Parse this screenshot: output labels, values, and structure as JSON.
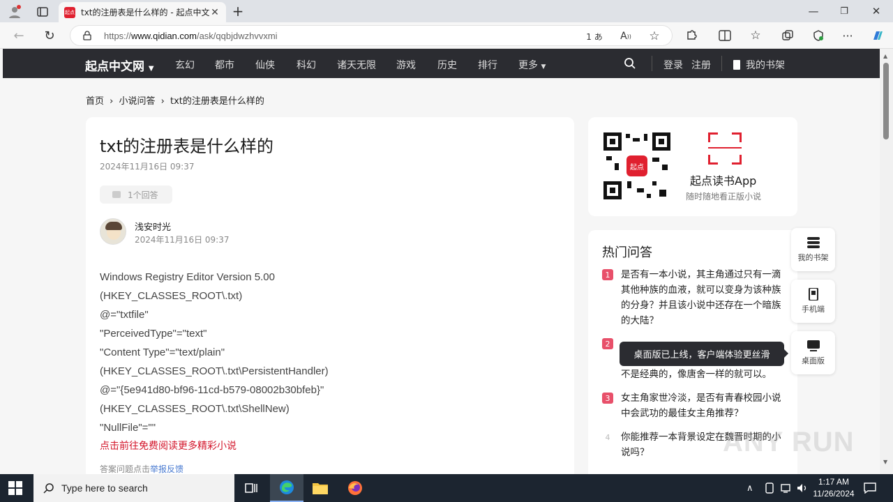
{
  "browser": {
    "tab_title": "txt的注册表是什么样的 - 起点中文",
    "favicon_text": "起点",
    "url_prefix": "https://",
    "url_domain": "www.qidian.com",
    "url_path": "/ask/qqbjdwzhvvxmi",
    "read_aloud_label": "1 あ"
  },
  "site": {
    "logo": "起点中文网",
    "nav": [
      "玄幻",
      "都市",
      "仙侠",
      "科幻",
      "诸天无限",
      "游戏",
      "历史",
      "排行",
      "更多"
    ],
    "login": "登录",
    "register": "注册",
    "bookshelf": "我的书架"
  },
  "breadcrumb": {
    "home": "首页",
    "section": "小说问答",
    "current": "txt的注册表是什么样的"
  },
  "question": {
    "title": "txt的注册表是什么样的",
    "date": "2024年11月16日 09:37",
    "answer_count": "1个回答"
  },
  "answer": {
    "author": "浅安时光",
    "date": "2024年11月16日 09:37",
    "lines": [
      "Windows Registry Editor Version 5.00",
      "(HKEY_CLASSES_ROOT\\.txt)",
      "@=\"txtfile\"",
      "\"PerceivedType\"=\"text\"",
      "\"Content Type\"=\"text/plain\"",
      "(HKEY_CLASSES_ROOT\\.txt\\PersistentHandler)",
      "@=\"{5e941d80-bf96-11cd-b579-08002b30bfeb}\"",
      "(HKEY_CLASSES_ROOT\\.txt\\ShellNew)",
      "\"NullFile\"=\"\""
    ],
    "cta": "点击前往免费阅读更多精彩小说",
    "report_prefix": "答案问题点击",
    "report_link": "举报反馈"
  },
  "app_promo": {
    "qr_label": "起点",
    "name": "起点读书App",
    "subtitle": "随时随地看正版小说"
  },
  "hot": {
    "title": "热门问答",
    "items": [
      {
        "rank": "1",
        "text": "是否有一本小说，其主角通过只有一滴其他种族的血液，就可以变身为该种族的分身？并且该小说中还存在一个暗族的大陆？"
      },
      {
        "rank": "2",
        "text": "不是经典的，像唐舍一样的就可以。"
      },
      {
        "rank": "3",
        "text": "女主角家世冷淡，是否有青春校园小说中会武功的最佳女主角推荐？"
      },
      {
        "rank": "4",
        "text": "你能推荐一本背景设定在魏晋时期的小说吗？"
      }
    ]
  },
  "side": {
    "bookshelf": "我的书架",
    "mobile": "手机端",
    "desktop": "桌面版",
    "tooltip": "桌面版已上线，客户端体验更丝滑"
  },
  "watermark": "ANY RUN",
  "taskbar": {
    "search_placeholder": "Type here to search",
    "time": "1:17 AM",
    "date": "11/26/2024"
  },
  "colors": {
    "brand_red": "#e0202f",
    "nav_bg": "#2b2c31",
    "rank_red": "#e8506a"
  }
}
